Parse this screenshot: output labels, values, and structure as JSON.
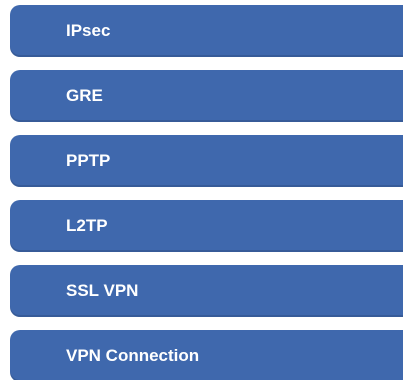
{
  "menu": {
    "items": [
      {
        "label": "IPsec"
      },
      {
        "label": "GRE"
      },
      {
        "label": "PPTP"
      },
      {
        "label": "L2TP"
      },
      {
        "label": "SSL VPN"
      },
      {
        "label": "VPN Connection"
      }
    ]
  },
  "colors": {
    "item_background": "#3f68ad",
    "item_text": "#ffffff",
    "page_background": "#ffffff"
  }
}
